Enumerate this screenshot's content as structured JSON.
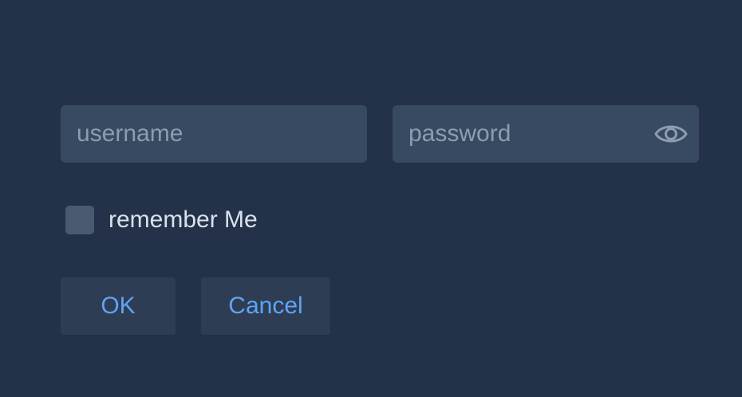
{
  "login_form": {
    "username": {
      "value": "",
      "placeholder": "username"
    },
    "password": {
      "value": "",
      "placeholder": "password",
      "toggle_icon": "eye-icon"
    },
    "remember": {
      "label": "remember Me",
      "checked": false
    },
    "buttons": {
      "ok_label": "OK",
      "cancel_label": "Cancel"
    }
  },
  "colors": {
    "background": "#243249",
    "input_background": "#384a61",
    "placeholder": "#8d9cb0",
    "checkbox": "#4a5a71",
    "label_text": "#d9e1ec",
    "button_background": "#2e3d53",
    "button_text": "#5ea4f7"
  }
}
